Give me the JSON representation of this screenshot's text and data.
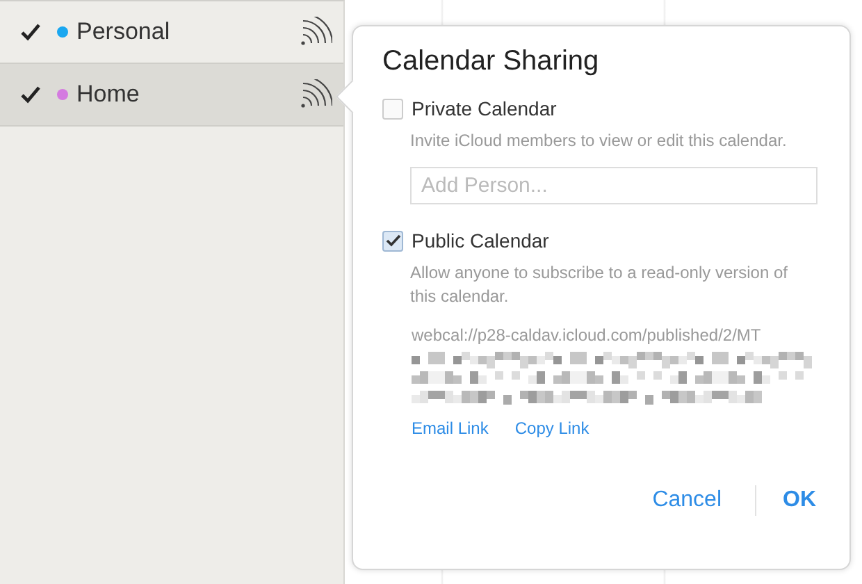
{
  "sidebar": {
    "items": [
      {
        "name": "Personal",
        "color": "#1aa7f0",
        "checked": true,
        "selected": false
      },
      {
        "name": "Home",
        "color": "#d47ae0",
        "checked": true,
        "selected": true
      }
    ]
  },
  "popover": {
    "title": "Calendar Sharing",
    "private": {
      "label": "Private Calendar",
      "checked": false,
      "description": "Invite iCloud members to view or edit this calendar.",
      "placeholder": "Add Person..."
    },
    "public": {
      "label": "Public Calendar",
      "checked": true,
      "description": "Allow anyone to subscribe to a read-only version of this calendar.",
      "url": "webcal://p28-caldav.icloud.com/published/2/MT"
    },
    "links": [
      "Email Link",
      "Copy Link"
    ],
    "buttons": [
      {
        "label": "Cancel",
        "kind": "secondary"
      },
      {
        "label": "OK",
        "kind": "primary"
      }
    ]
  }
}
